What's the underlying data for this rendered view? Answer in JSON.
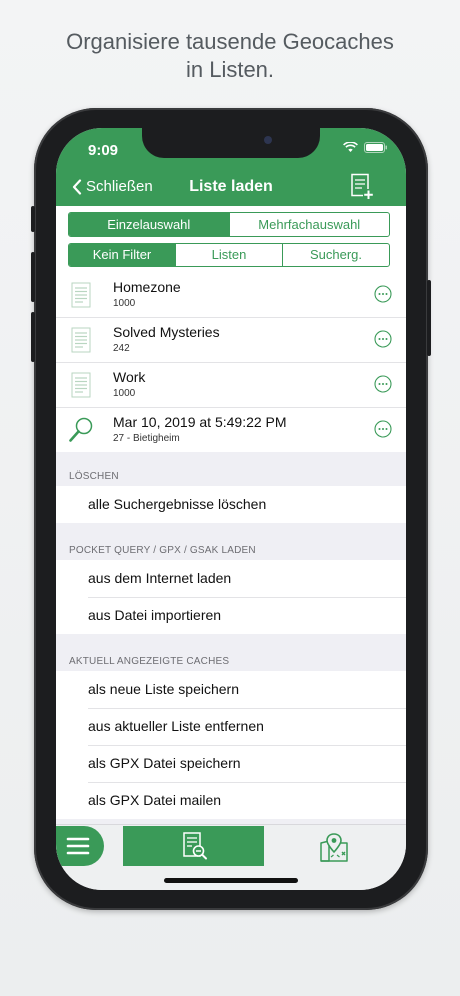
{
  "caption": {
    "line1": "Organisiere tausende Geocaches",
    "line2": "in Listen."
  },
  "status_bar": {
    "time": "9:09"
  },
  "nav": {
    "back_label": "Schließen",
    "title": "Liste laden",
    "add_icon": "add-list-icon"
  },
  "segments_mode": {
    "options": [
      "Einzelauswahl",
      "Mehrfachauswahl"
    ],
    "selected": "Einzelauswahl"
  },
  "segments_filter": {
    "options": [
      "Kein Filter",
      "Listen",
      "Sucherg."
    ],
    "selected": "Kein Filter"
  },
  "lists": [
    {
      "title": "Homezone",
      "subtitle": "1000",
      "icon": "document-icon"
    },
    {
      "title": "Solved Mysteries",
      "subtitle": "242",
      "icon": "document-icon"
    },
    {
      "title": "Work",
      "subtitle": "1000",
      "icon": "document-icon"
    },
    {
      "title": "Mar 10, 2019 at 5:49:22 PM",
      "subtitle": "27 - Bietigheim",
      "icon": "magnifier-icon"
    }
  ],
  "sections": {
    "delete": {
      "header": "LÖSCHEN",
      "items": [
        "alle Suchergebnisse löschen"
      ]
    },
    "pocket_query": {
      "header": "POCKET QUERY / GPX / GSAK LADEN",
      "items": [
        "aus dem Internet laden",
        "aus Datei importieren"
      ]
    },
    "current": {
      "header": "AKTUELL ANGEZEIGTE CACHES",
      "items": [
        "als neue Liste speichern",
        "aus aktueller Liste entfernen",
        "als GPX Datei speichern",
        "als GPX Datei mailen"
      ]
    }
  },
  "tabbar": {
    "menu_icon": "hamburger-icon",
    "list_icon": "list-search-icon",
    "map_icon": "map-pin-icon"
  },
  "colors": {
    "accent": "#3a9a58",
    "background": "#efeff4"
  }
}
